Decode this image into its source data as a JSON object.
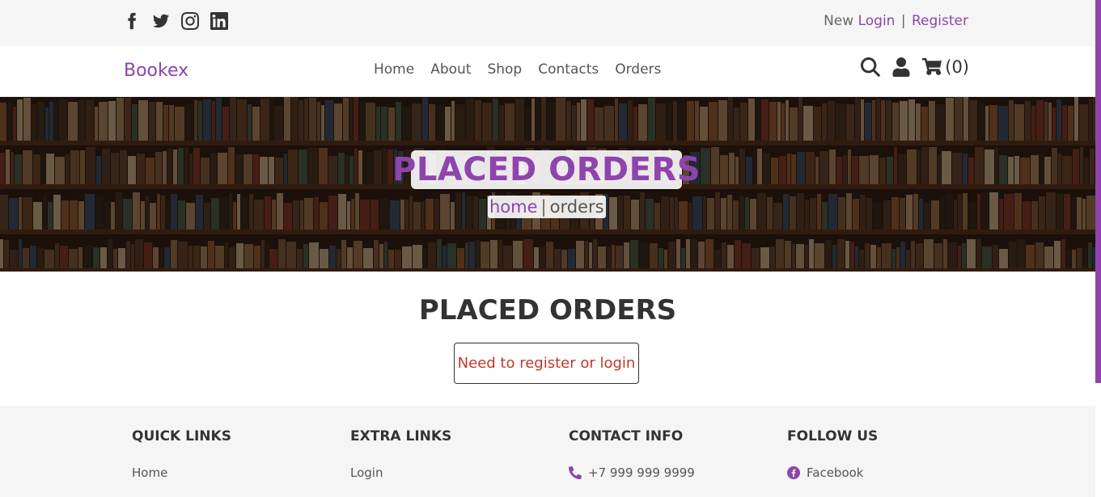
{
  "colors": {
    "accent": "#8e44ad",
    "warning": "#c0392b",
    "text": "#333333",
    "bg_light": "#f5f5f5"
  },
  "topbar": {
    "social_icons": [
      "facebook-icon",
      "twitter-icon",
      "instagram-icon",
      "linkedin-icon"
    ],
    "new_label": "New",
    "login_label": "Login",
    "separator": "|",
    "register_label": "Register"
  },
  "header": {
    "logo": "Bookex",
    "nav": [
      "Home",
      "About",
      "Shop",
      "Contacts",
      "Orders"
    ],
    "icons": [
      "search-icon",
      "user-icon",
      "cart-icon"
    ],
    "cart_count": "(0)"
  },
  "hero": {
    "title": "PLACED ORDERS",
    "crumb_home": "home",
    "crumb_sep": "|",
    "crumb_current": "orders"
  },
  "main": {
    "title": "PLACED ORDERS",
    "empty_message": "Need to register or login"
  },
  "footer": {
    "quick_links": {
      "heading": "QUICK LINKS",
      "first": "Home"
    },
    "extra_links": {
      "heading": "EXTRA LINKS",
      "first": "Login"
    },
    "contact_info": {
      "heading": "CONTACT INFO",
      "first": "+7 999 999 9999"
    },
    "follow_us": {
      "heading": "FOLLOW US",
      "first": "Facebook"
    }
  }
}
